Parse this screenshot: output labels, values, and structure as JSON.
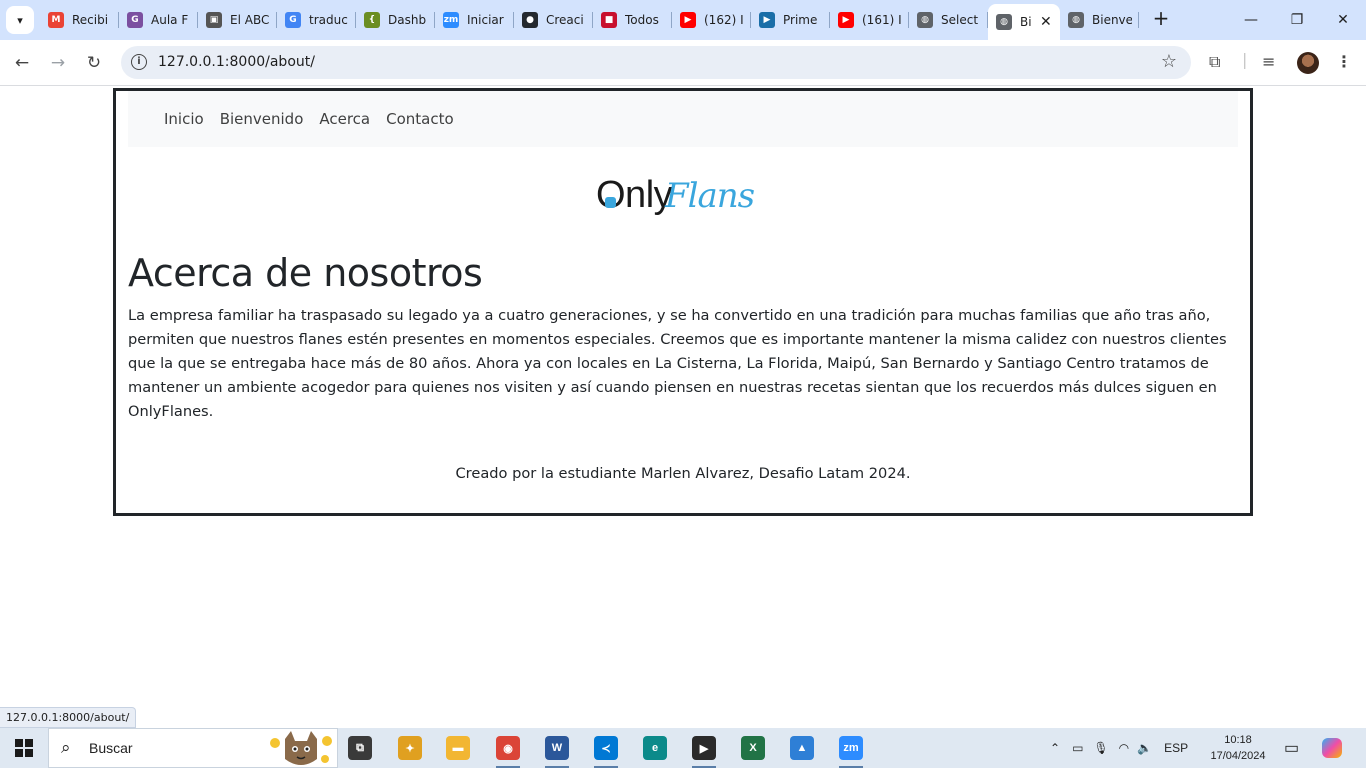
{
  "browser": {
    "tabs": [
      {
        "label": "Recibi",
        "icon": "gmail-icon",
        "color": "#ea4335",
        "glyph": "M"
      },
      {
        "label": "Aula F",
        "icon": "aula-icon",
        "color": "#7b4fa0",
        "glyph": "G"
      },
      {
        "label": "El ABC",
        "icon": "chip-icon",
        "color": "#555555",
        "glyph": "▣"
      },
      {
        "label": "traduc",
        "icon": "google-icon",
        "color": "#4285f4",
        "glyph": "G"
      },
      {
        "label": "Dashb",
        "icon": "dashboard-icon",
        "color": "#6b8e23",
        "glyph": "{"
      },
      {
        "label": "Iniciar",
        "icon": "zoom-icon",
        "color": "#2d8cff",
        "glyph": "zm"
      },
      {
        "label": "Creaci",
        "icon": "github-icon",
        "color": "#24292f",
        "glyph": "●"
      },
      {
        "label": "Todos",
        "icon": "todos-icon",
        "color": "#c8102e",
        "glyph": "■"
      },
      {
        "label": "(162) I",
        "icon": "youtube-icon",
        "color": "#ff0000",
        "glyph": "▶"
      },
      {
        "label": "Prime",
        "icon": "prime-icon",
        "color": "#1a6ea8",
        "glyph": "▶"
      },
      {
        "label": "(161) I",
        "icon": "youtube-icon",
        "color": "#ff0000",
        "glyph": "▶"
      },
      {
        "label": "Select",
        "icon": "globe-icon",
        "color": "#5f6368",
        "glyph": "◍"
      },
      {
        "label": "Bi",
        "icon": "globe-icon",
        "color": "#5f6368",
        "glyph": "◍",
        "active": true
      },
      {
        "label": "Bienve",
        "icon": "globe-icon",
        "color": "#5f6368",
        "glyph": "◍"
      }
    ],
    "url": "127.0.0.1:8000/about/",
    "status_url": "127.0.0.1:8000/about/"
  },
  "site": {
    "nav": [
      "Inicio",
      "Bienvenido",
      "Acerca",
      "Contacto"
    ],
    "logo": {
      "only": "Only",
      "flans": "Flans"
    },
    "title": "Acerca de nosotros",
    "paragraph": "La empresa familiar ha traspasado su legado ya a cuatro generaciones, y se ha convertido en una tradición para muchas familias que año tras año, permiten que nuestros flanes estén presentes en momentos especiales. Creemos que es importante mantener la misma calidez con nuestros clientes que la que se entregaba hace más de 80 años. Ahora ya con locales en La Cisterna, La Florida, Maipú, San Bernardo y Santiago Centro tratamos de mantener un ambiente acogedor para quienes nos visiten y así cuando piensen en nuestras recetas sientan que los recuerdos más dulces siguen en OnlyFlanes.",
    "footer": "Creado por la estudiante Marlen Alvarez, Desafio Latam 2024."
  },
  "taskbar": {
    "search_label": "Buscar",
    "apps": [
      {
        "name": "task-view-icon",
        "color": "#3a3a3a",
        "glyph": "⧉"
      },
      {
        "name": "gallery-icon",
        "color": "#e0a020",
        "glyph": "✦"
      },
      {
        "name": "file-explorer-icon",
        "color": "#f2b632",
        "glyph": "▬"
      },
      {
        "name": "chrome-icon",
        "color": "#db4437",
        "glyph": "◉",
        "open": true
      },
      {
        "name": "word-icon",
        "color": "#2b579a",
        "glyph": "W",
        "open": true
      },
      {
        "name": "vscode-icon",
        "color": "#0078d4",
        "glyph": "≺",
        "open": true
      },
      {
        "name": "edge-icon",
        "color": "#0c8a8a",
        "glyph": "e"
      },
      {
        "name": "media-player-icon",
        "color": "#2a2a2a",
        "glyph": "▶",
        "open": true
      },
      {
        "name": "excel-icon",
        "color": "#217346",
        "glyph": "X"
      },
      {
        "name": "photos-icon",
        "color": "#2e7fd6",
        "glyph": "▲"
      },
      {
        "name": "zoom-icon",
        "color": "#2d8cff",
        "glyph": "zm",
        "open": true
      }
    ],
    "language": "ESP",
    "time": "10:18",
    "date": "17/04/2024"
  },
  "colors": {
    "tabstrip": "#d3e3fd",
    "omnibox": "#e9eef6",
    "logo_blue": "#3aa6dd",
    "text": "#212529"
  }
}
